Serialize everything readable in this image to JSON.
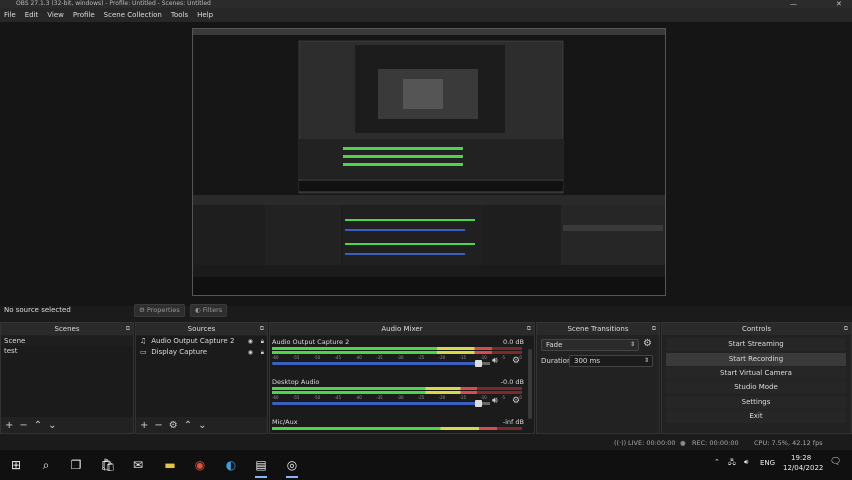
{
  "window": {
    "title": "OBS 27.1.3 (32-bit, windows) - Profile: Untitled - Scenes: Untitled",
    "minimize": "—",
    "close": "✕"
  },
  "menu": [
    "File",
    "Edit",
    "View",
    "Profile",
    "Scene Collection",
    "Tools",
    "Help"
  ],
  "status_source": "No source selected",
  "buttons": {
    "properties": "Properties",
    "filters": "Filters"
  },
  "scenes": {
    "title": "Scenes",
    "items": [
      "Scene",
      "test"
    ]
  },
  "sources": {
    "title": "Sources",
    "items": [
      {
        "name": "Audio Output Capture 2",
        "icon": "speaker-icon"
      },
      {
        "name": "Display Capture",
        "icon": "monitor-icon"
      }
    ]
  },
  "mixer": {
    "title": "Audio Mixer",
    "tracks": [
      {
        "name": "Audio Output Capture 2",
        "db": "0.0 dB",
        "level": 0.88
      },
      {
        "name": "Desktop Audio",
        "db": "-0.0 dB",
        "level": 0.82
      },
      {
        "name": "Mic/Aux",
        "db": "-inf dB",
        "level": 0.9
      }
    ],
    "ticks": [
      "-60",
      "-55",
      "-50",
      "-45",
      "-40",
      "-35",
      "-30",
      "-25",
      "-20",
      "-15",
      "-10",
      "-5",
      "0"
    ]
  },
  "transitions": {
    "title": "Scene Transitions",
    "selected": "Fade",
    "duration_label": "Duration",
    "duration_value": "300 ms"
  },
  "controls": {
    "title": "Controls",
    "buttons": [
      "Start Streaming",
      "Start Recording",
      "Start Virtual Camera",
      "Studio Mode",
      "Settings",
      "Exit"
    ],
    "highlighted": 1
  },
  "status": {
    "live": "LIVE: 00:00:00",
    "rec": "REC: 00:00:00",
    "cpu": "CPU: 7.5%, 42.12 fps"
  },
  "taskbar": {
    "language": "ENG",
    "time": "19:28",
    "date": "12/04/2022"
  }
}
